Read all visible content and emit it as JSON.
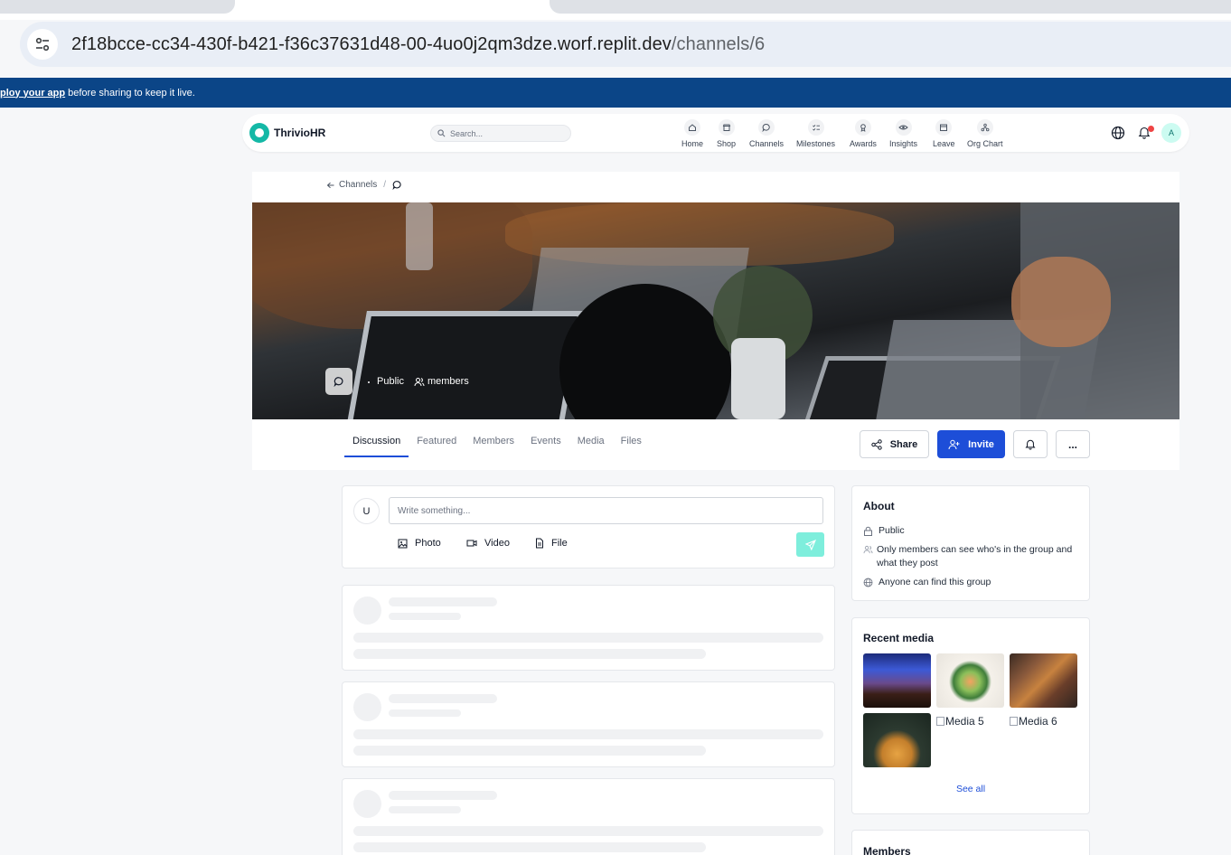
{
  "browser": {
    "url_host": "2f18bcce-cc34-430f-b421-f36c37631d48-00-4uo0j2qm3dze.worf.replit.dev",
    "url_path": "/channels/6",
    "notice_link": "ploy your app",
    "notice_text": "before sharing to keep it live."
  },
  "nav": {
    "brand": "ThrivioHR",
    "search_placeholder": "Search...",
    "items": [
      {
        "label": "Home",
        "icon": "home-icon"
      },
      {
        "label": "Shop",
        "icon": "store-icon"
      },
      {
        "label": "Channels",
        "icon": "chat-icon"
      },
      {
        "label": "Milestones",
        "icon": "checklist-icon"
      },
      {
        "label": "Awards",
        "icon": "award-icon"
      },
      {
        "label": "Insights",
        "icon": "eye-icon"
      },
      {
        "label": "Leave",
        "icon": "calendar-icon"
      },
      {
        "label": "Org Chart",
        "icon": "org-chart-icon"
      }
    ],
    "notification_count": "1",
    "avatar_initial": "A"
  },
  "breadcrumb": {
    "back_label": "Channels",
    "separator": "/"
  },
  "cover": {
    "privacy": "Public",
    "members_label": "members"
  },
  "tabs": [
    "Discussion",
    "Featured",
    "Members",
    "Events",
    "Media",
    "Files"
  ],
  "actions": {
    "share": "Share",
    "invite": "Invite",
    "more": "..."
  },
  "composer": {
    "avatar_initial": "U",
    "placeholder": "Write something...",
    "photo": "Photo",
    "video": "Video",
    "file": "File"
  },
  "about": {
    "title": "About",
    "privacy": "Public",
    "visibility": "Only members can see who's in the group and what they post",
    "findability": "Anyone can find this group"
  },
  "recent_media": {
    "title": "Recent media",
    "alt_5": "Media 5",
    "alt_6": "Media 6",
    "see_all": "See all"
  },
  "members": {
    "title": "Members"
  },
  "colors": {
    "brand_teal": "#14b8a6",
    "primary_blue": "#1d4ed8",
    "notice_bar": "#0b4587"
  }
}
